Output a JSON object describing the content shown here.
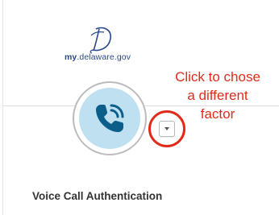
{
  "logo": {
    "text_my": "my",
    "text_rest": ".delaware.gov",
    "icon": "delaware-d-monogram"
  },
  "factor": {
    "icon": "phone-ringing-icon",
    "dropdown_icon": "caret-down-icon"
  },
  "annotation": {
    "lines": [
      "Click to chose",
      "a different",
      "factor"
    ],
    "color": "#e02b1a"
  },
  "content": {
    "heading": "Voice Call Authentication"
  },
  "colors": {
    "brand_blue": "#2b4a8b",
    "icon_blue": "#0b5e8a",
    "factor_bg": "#bfe0f1"
  }
}
